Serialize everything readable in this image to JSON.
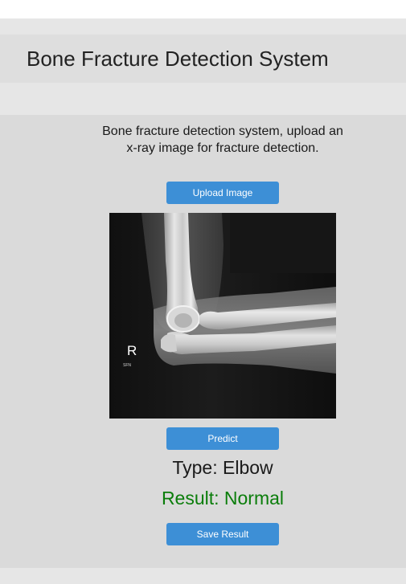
{
  "header": {
    "title": "Bone Fracture Detection System"
  },
  "main": {
    "instructions": "Bone fracture detection system, upload an x-ray image for fracture detection.",
    "upload_label": "Upload Image",
    "predict_label": "Predict",
    "save_label": "Save Result",
    "type_text": "Type: Elbow",
    "result_text": "Result: Normal",
    "result_color": "#0a7d0a",
    "button_color": "#3d8fd6"
  },
  "xray_image": {
    "marker_letter": "R",
    "marker_caption": "SFN"
  }
}
